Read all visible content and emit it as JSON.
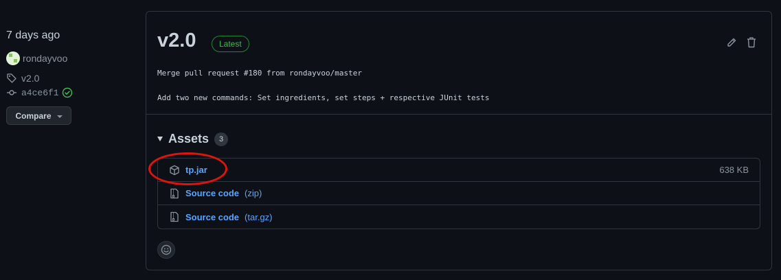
{
  "sidebar": {
    "time": "7 days ago",
    "author": "rondayvoo",
    "tag": "v2.0",
    "commit": "a4ce6f1",
    "compare_label": "Compare"
  },
  "release": {
    "title": "v2.0",
    "badge": "Latest",
    "description_line1": "Merge pull request #180 from rondayvoo/master",
    "description_line2": "Add two new commands: Set ingredients, set steps + respective JUnit tests"
  },
  "assets": {
    "title": "Assets",
    "count": "3",
    "items": [
      {
        "name": "tp.jar",
        "sub": "",
        "size": "638 KB",
        "icon": "package-icon"
      },
      {
        "name": "Source code",
        "sub": "(zip)",
        "size": "",
        "icon": "file-zip-icon"
      },
      {
        "name": "Source code",
        "sub": "(tar.gz)",
        "size": "",
        "icon": "file-zip-icon"
      }
    ]
  },
  "colors": {
    "background": "#0d1117",
    "link": "#58a6ff",
    "latest_green": "#3fb950",
    "annotation_red": "#e0140f"
  }
}
